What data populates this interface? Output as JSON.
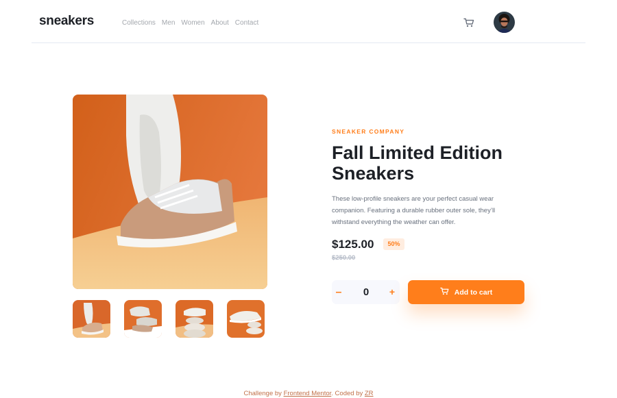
{
  "nav": {
    "logo": "sneakers",
    "links": [
      "Collections",
      "Men",
      "Women",
      "About",
      "Contact"
    ]
  },
  "icons": {
    "cart": "cart-icon",
    "avatar": "avatar-image"
  },
  "product": {
    "company": "SNEAKER COMPANY",
    "title": "Fall Limited Edition Sneakers",
    "description": "These low-profile sneakers are your perfect casual wear companion. Featuring a durable rubber outer sole, they’ll withstand everything the weather can offer.",
    "price": "$125.00",
    "discount": "50%",
    "old_price": "$250.00"
  },
  "cart": {
    "minus": "–",
    "quantity": "0",
    "plus": "+",
    "add_label": "Add to cart"
  },
  "footer": {
    "prefix": "Challenge by ",
    "link1": "Frontend Mentor",
    "middle": ". Coded by ",
    "link2": "ZR"
  },
  "colors": {
    "accent": "#ff7e1b",
    "accent_pale": "#ffede0",
    "text_dark": "#1d2026",
    "text_muted": "#68707d"
  }
}
